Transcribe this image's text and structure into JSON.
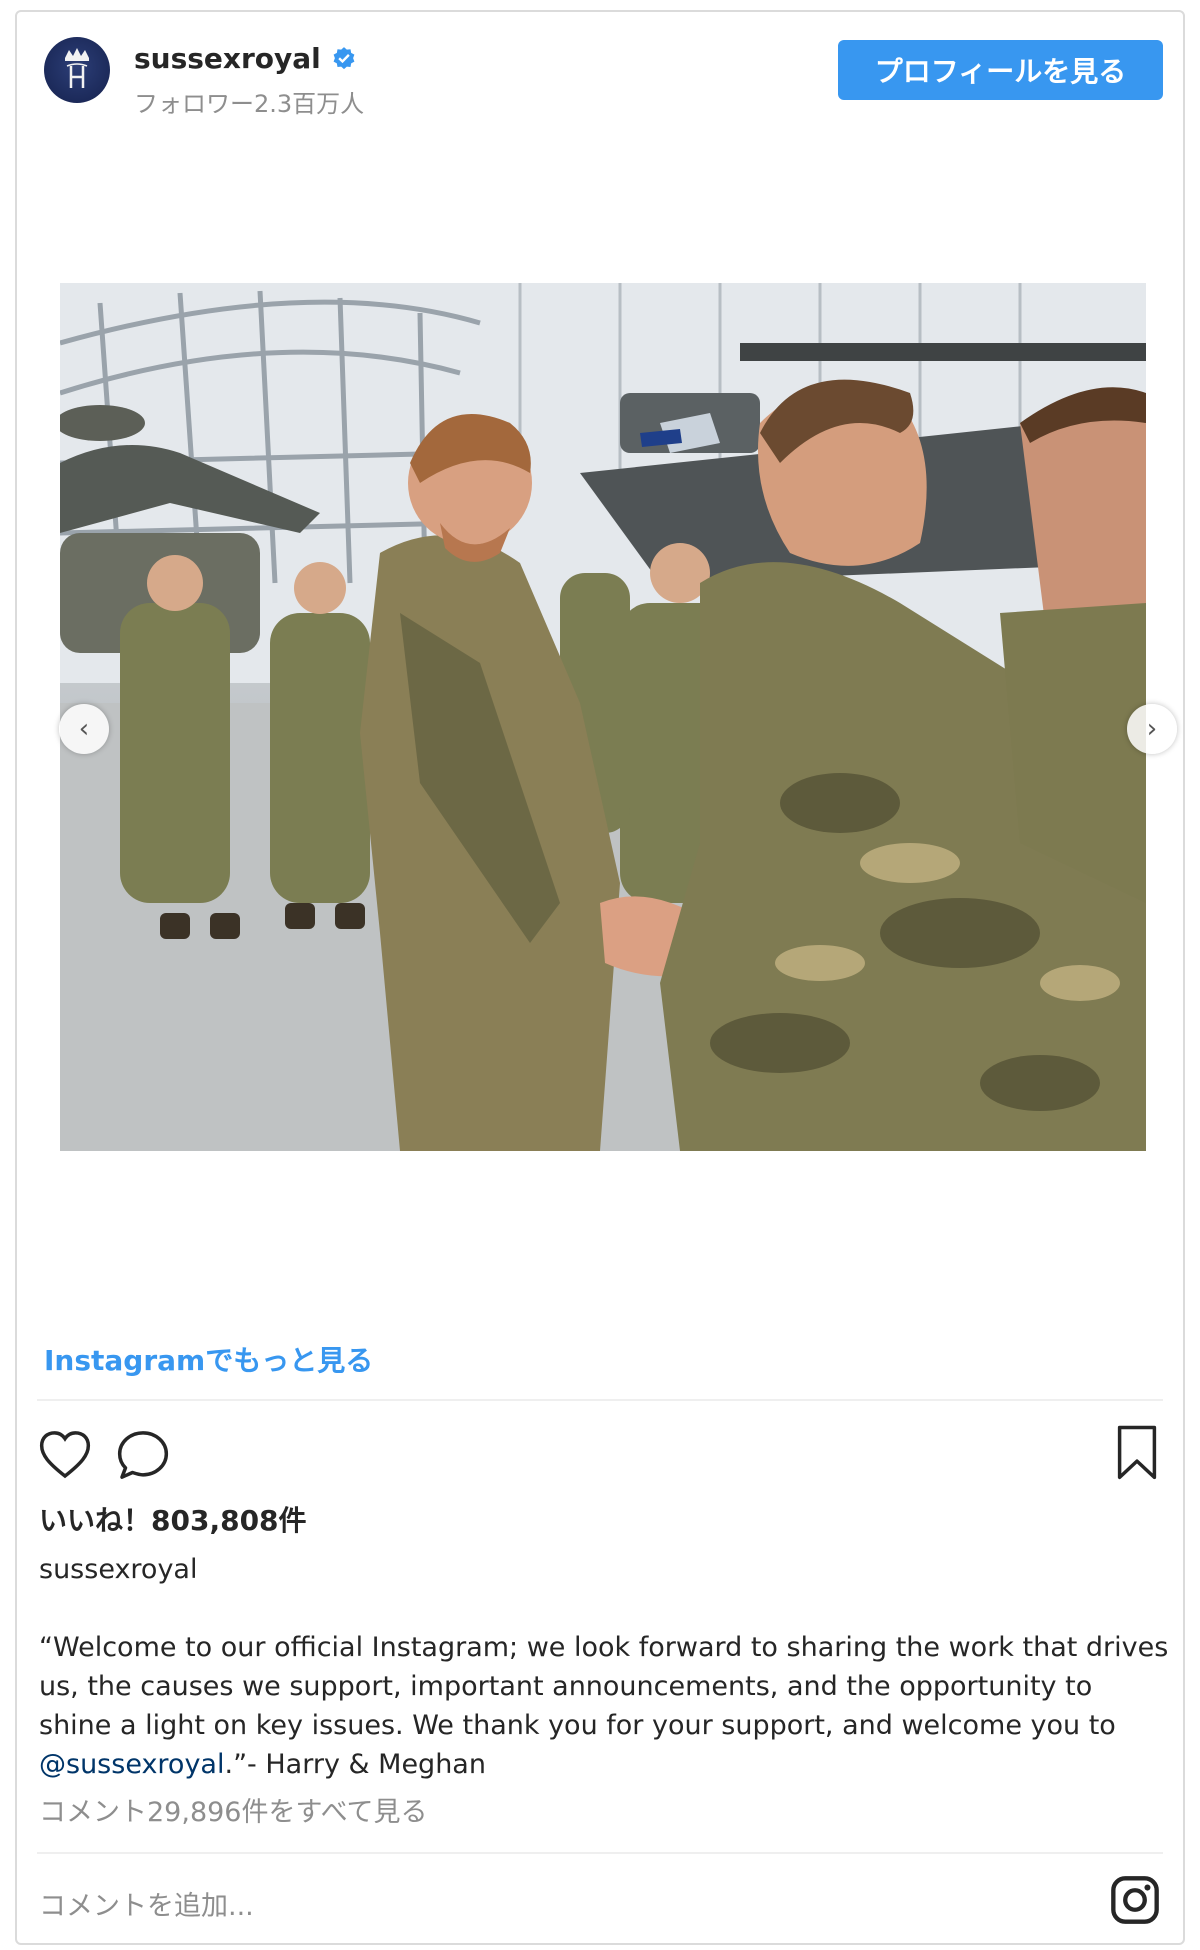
{
  "header": {
    "username": "sussexroyal",
    "followers": "フォロワー2.3百万人",
    "profile_button": "プロフィールを見る",
    "verified_icon": "verified-badge-icon",
    "accent": "#3897f0"
  },
  "carousel": {
    "prev_icon": "‹",
    "next_icon": "›"
  },
  "more_link": "Instagramでもっと見る",
  "actions": {
    "likes": "いいね！803,808件"
  },
  "caption": {
    "username": "sussexroyal",
    "text": "“Welcome to our official Instagram; we look forward to sharing the work that drives us, the causes we support, important announcements, and the opportunity to shine a light on key issues. We thank you for your support, and welcome you to ",
    "mention": "@sussexroyal",
    "text_after": ".”- Harry & Meghan",
    "view_comments": "コメント29,896件をすべて見る"
  },
  "comment_box": {
    "placeholder": "コメントを追加..."
  }
}
